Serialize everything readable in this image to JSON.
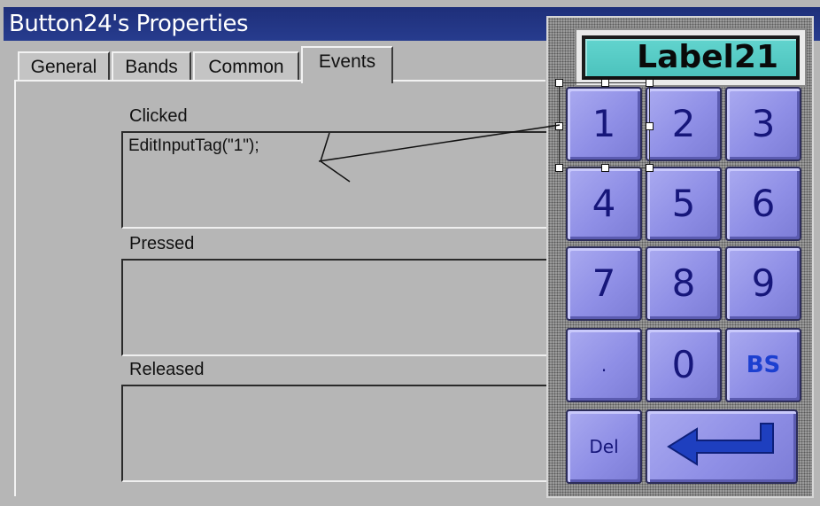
{
  "dialog": {
    "title": "Button24's Properties",
    "tabs": [
      {
        "label": "General"
      },
      {
        "label": "Bands"
      },
      {
        "label": "Common"
      },
      {
        "label": "Events",
        "active": true
      }
    ],
    "events": [
      {
        "label": "Clicked",
        "code": "EditInputTag(\"1\");"
      },
      {
        "label": "Pressed",
        "code": ""
      },
      {
        "label": "Released",
        "code": ""
      }
    ]
  },
  "keypad": {
    "display_label": "Label21",
    "keys": {
      "k1": "1",
      "k2": "2",
      "k3": "3",
      "k4": "4",
      "k5": "5",
      "k6": "6",
      "k7": "7",
      "k8": "8",
      "k9": "9",
      "dot": ".",
      "k0": "0",
      "bs": "BS",
      "del": "Del",
      "enter_icon": "enter-arrow-icon"
    }
  },
  "colors": {
    "titlebar": "#273c8e",
    "dialog_bg": "#b6b6b6",
    "key_face": "#8f8fe6",
    "key_text": "#16167a",
    "bs_text": "#1c3fd0",
    "label_bg": "#4cc3bd"
  }
}
